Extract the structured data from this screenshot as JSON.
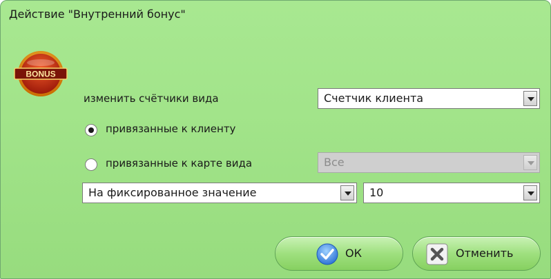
{
  "window": {
    "title": "Действие \"Внутренний бонус\""
  },
  "logo": {
    "text": "BONUS"
  },
  "form": {
    "change_counters_label": "изменить счётчики вида",
    "counter_type_value": "Счетчик клиента",
    "radio_client_label": "привязанные к клиенту",
    "radio_card_label": "привязанные к карте вида",
    "card_type_value": "Все",
    "operation_value": "На фиксированное значение",
    "amount_value": "10"
  },
  "buttons": {
    "ok_label": "ОК",
    "cancel_label": "Отменить"
  },
  "state": {
    "selected_radio": "client"
  },
  "colors": {
    "background": "#a2e48a",
    "button": "#9fe07f",
    "disabled_field": "#cfcfcf"
  }
}
